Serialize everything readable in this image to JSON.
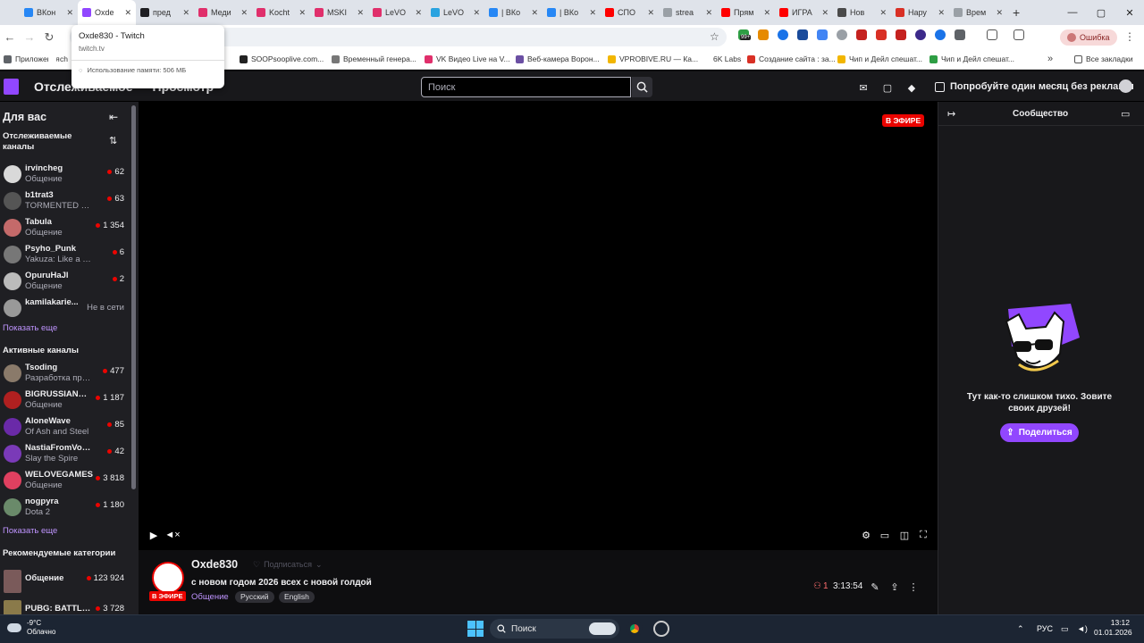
{
  "browser": {
    "tabs": [
      {
        "label": "ВКон",
        "color": "#2787f5"
      },
      {
        "label": "Oxde",
        "color": "#9147ff",
        "active": true
      },
      {
        "label": "пред",
        "color": "#1f1f23"
      },
      {
        "label": "Меди",
        "color": "#e02f6b"
      },
      {
        "label": "Kocht",
        "color": "#e02f6b"
      },
      {
        "label": "MSKI",
        "color": "#e02f6b"
      },
      {
        "label": "LeVO",
        "color": "#e02f6b"
      },
      {
        "label": "LeVO",
        "color": "#2aa3e0"
      },
      {
        "label": "| ВКо",
        "color": "#2787f5"
      },
      {
        "label": "| ВКо",
        "color": "#2787f5"
      },
      {
        "label": "СПО",
        "color": "#ff0000"
      },
      {
        "label": "strea",
        "color": "#9aa0a6"
      },
      {
        "label": "Прям",
        "color": "#ff0000"
      },
      {
        "label": "ИГРА",
        "color": "#ff0000"
      },
      {
        "label": "Нов",
        "color": "#4a4a4a"
      },
      {
        "label": "Нару",
        "color": "#d93025"
      },
      {
        "label": "Врем",
        "color": "#9aa0a6"
      }
    ],
    "new_tab": "+",
    "window_controls": {
      "minimize": "—",
      "maximize": "▢",
      "close": "✕"
    },
    "tooltip": {
      "title": "Oxde830 - Twitch",
      "url": "twitch.tv",
      "memory": "Использование памяти: 506 МБ"
    },
    "ext_badge": "99+",
    "error_label": "Ошибка",
    "bookmarks": [
      {
        "label": "Приложения",
        "color": "#5f6368"
      },
      {
        "label": "ch",
        "color": "#ffffff"
      },
      {
        "label": "SOOPsooplive.com...",
        "color": "#222222"
      },
      {
        "label": "Временный генера...",
        "color": "#777777"
      },
      {
        "label": "VK Видео Live на V...",
        "color": "#e02f6b"
      },
      {
        "label": "Веб-камера Ворон...",
        "color": "#6b4fa3"
      },
      {
        "label": "VPROBIVE.RU — Ка...",
        "color": "#f2b600"
      },
      {
        "label": "6K Labs",
        "color": "#ffffff"
      },
      {
        "label": "Создание сайта : за...",
        "color": "#d93025"
      },
      {
        "label": "Чип и Дейл спешат...",
        "color": "#f2b600"
      },
      {
        "label": "Чип и Дейл спешат...",
        "color": "#2e9e44"
      }
    ],
    "all_bookmarks": "Все закладки"
  },
  "twitch": {
    "nav": {
      "following": "Отслеживаемое",
      "browse": "Просмотр"
    },
    "search_placeholder": "Поиск",
    "promo": "Попробуйте один месяц без рекламы",
    "sidebar": {
      "for_you": "Для вас",
      "followed_header": "Отслеживаемые каналы",
      "followed": [
        {
          "name": "irvincheg",
          "game": "Общение",
          "viewers": "62",
          "color": "#d9d9d9"
        },
        {
          "name": "b1trat3",
          "game": "TORMENTED SOULS...",
          "viewers": "63",
          "color": "#555"
        },
        {
          "name": "Tabula",
          "game": "Общение",
          "viewers": "1 354",
          "color": "#c46a6a"
        },
        {
          "name": "Psyho_Punk",
          "game": "Yakuza: Like a Dragon",
          "viewers": "6",
          "color": "#777"
        },
        {
          "name": "OpuruHaJl",
          "game": "Общение",
          "viewers": "2",
          "color": "#bbb"
        },
        {
          "name": "kamilakarie...",
          "game": "",
          "offline": "Не в сети",
          "color": "#999"
        }
      ],
      "show_more": "Показать еще",
      "active_header": "Активные каналы",
      "active": [
        {
          "name": "Tsoding",
          "game": "Разработка программ",
          "viewers": "477",
          "color": "#8a7a6a"
        },
        {
          "name": "BIGRUSSIANMAN",
          "game": "Общение",
          "viewers": "1 187",
          "color": "#b02020"
        },
        {
          "name": "AloneWave",
          "game": "Of Ash and Steel",
          "viewers": "85",
          "color": "#6a2aa8"
        },
        {
          "name": "NastiaFromVoronezh",
          "game": "Slay the Spire",
          "viewers": "42",
          "color": "#7a3ab8"
        },
        {
          "name": "WELOVEGAMES",
          "game": "Общение",
          "viewers": "3 818",
          "color": "#e04060"
        },
        {
          "name": "nogpyra",
          "game": "Dota 2",
          "viewers": "1 180",
          "color": "#6a8a6a"
        }
      ],
      "show_more2": "Показать еще",
      "rec_header": "Рекомендуемые категории",
      "categories": [
        {
          "name": "Общение",
          "viewers": "123 924",
          "color": "#7a5a5a"
        },
        {
          "name": "PUBG: BATTLEGROUNDS",
          "viewers": "3 728",
          "color": "#8a7a4a"
        }
      ]
    },
    "player": {
      "live_badge": "В ЭФИРЕ"
    },
    "info": {
      "channel": "Oxde830",
      "follow_label": "Подписаться",
      "live_badge": "В ЭФИРЕ",
      "title": "с новом годом 2026 всех с новой голдой",
      "category": "Общение",
      "tags": [
        "Русский",
        "English"
      ],
      "viewers": "1",
      "uptime": "3:13:54"
    },
    "chat": {
      "title": "Сообщество",
      "empty_text": "Тут как-то слишком тихо. Зовите своих друзей!",
      "share_label": "Поделиться"
    }
  },
  "taskbar": {
    "temp": "-9°C",
    "weather": "Облачно",
    "search": "Поиск",
    "lang": "РУС",
    "time": "13:12",
    "date": "01.01.2026"
  }
}
